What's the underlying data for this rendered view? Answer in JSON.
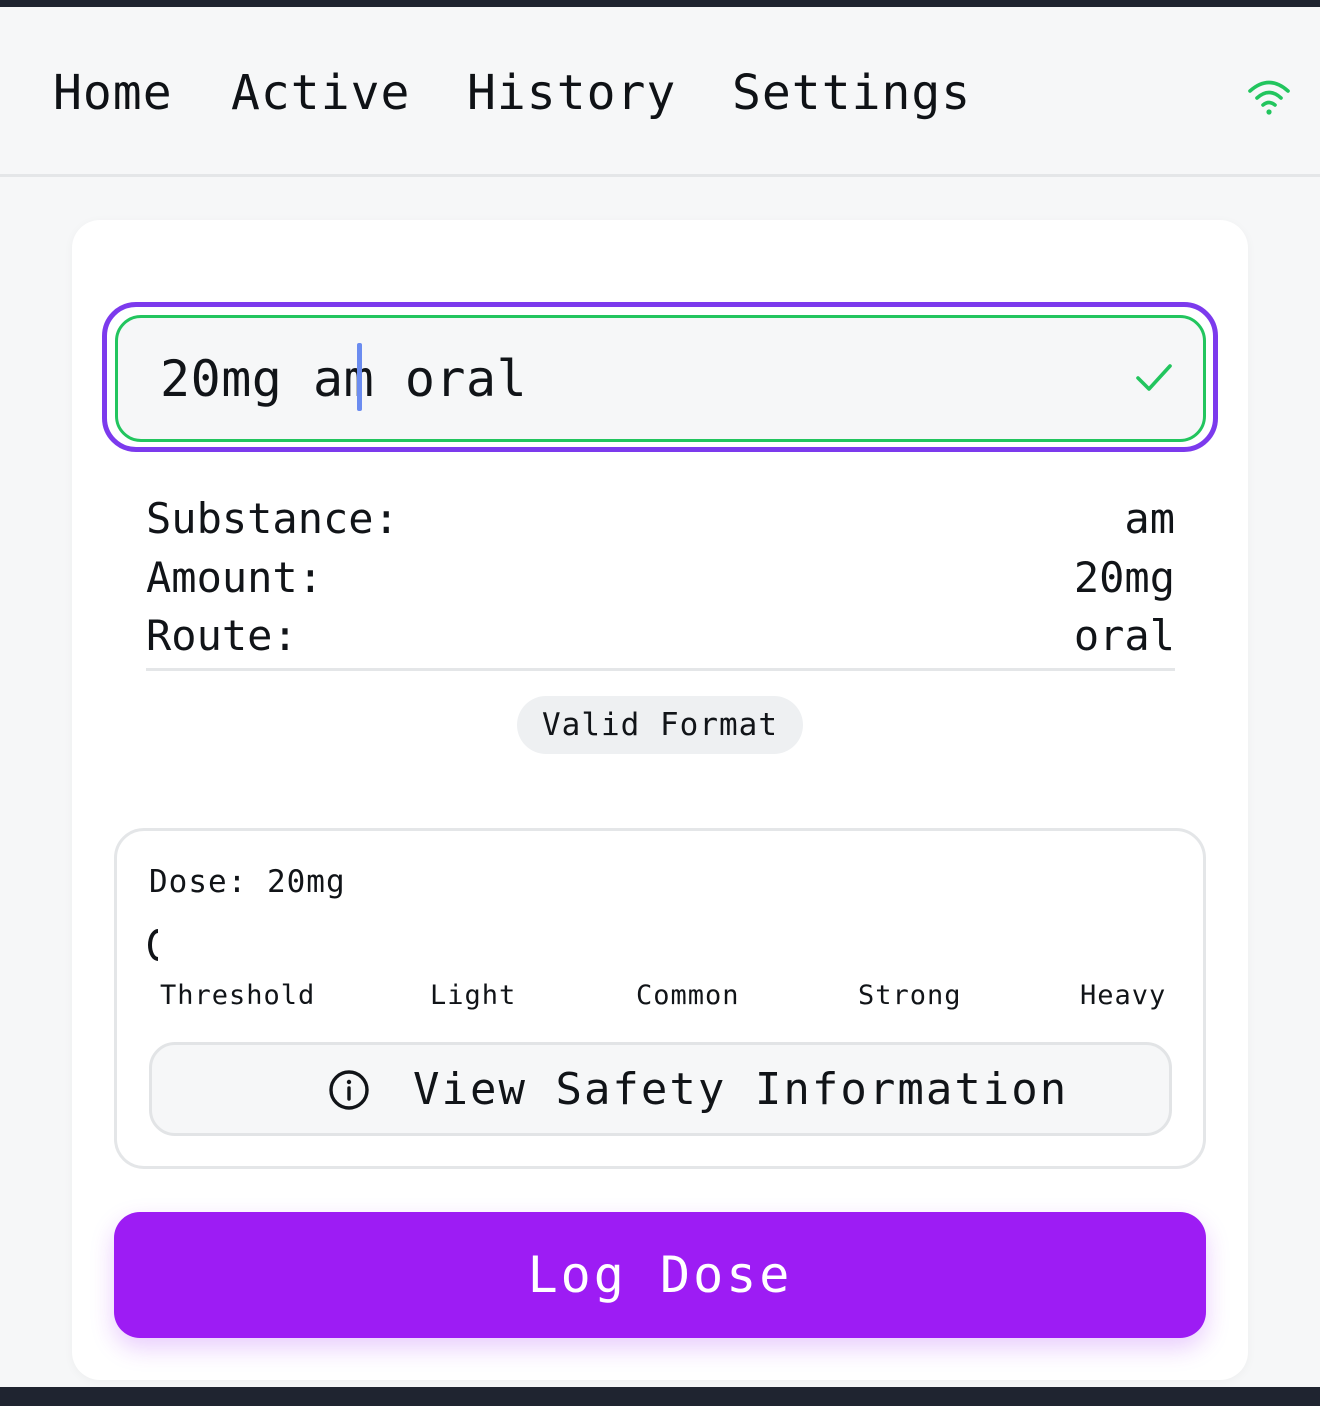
{
  "nav": {
    "items": [
      {
        "label": "Home"
      },
      {
        "label": "Active"
      },
      {
        "label": "History"
      },
      {
        "label": "Settings"
      }
    ],
    "status_icon": "wifi-icon",
    "status_color": "#22c55e"
  },
  "dose_input": {
    "value": "20mg am oral",
    "focus_color": "#7c3aed",
    "valid_color": "#22c55e",
    "status_icon": "check-icon"
  },
  "parsed": {
    "substance_label": "Substance:",
    "substance_value": "am",
    "amount_label": "Amount:",
    "amount_value": "20mg",
    "route_label": "Route:",
    "route_value": "oral"
  },
  "format_badge": "Valid Format",
  "dose_card": {
    "dose_label": "Dose: 20mg",
    "levels": [
      "Threshold",
      "Light",
      "Common",
      "Strong",
      "Heavy"
    ]
  },
  "safety_button": {
    "label": "View Safety Information",
    "icon": "info-icon"
  },
  "log_button": {
    "label": "Log Dose",
    "color": "#9d1cf4"
  }
}
